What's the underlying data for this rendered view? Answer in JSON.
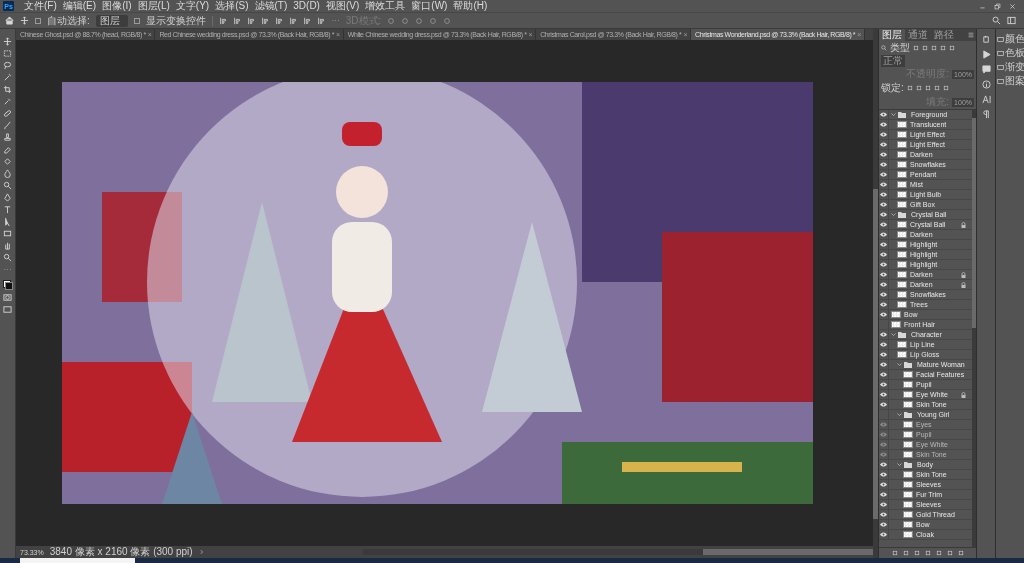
{
  "app_logo": "Ps",
  "menu": [
    "文件(F)",
    "编辑(E)",
    "图像(I)",
    "图层(L)",
    "文字(Y)",
    "选择(S)",
    "滤镜(T)",
    "3D(D)",
    "视图(V)",
    "增效工具",
    "窗口(W)",
    "帮助(H)"
  ],
  "options": {
    "auto_select_label": "自动选择:",
    "auto_select_checked": false,
    "target": "图层",
    "show_transform_label": "显示变换控件",
    "show_transform_checked": false,
    "mode_3d": "3D模式:"
  },
  "document_tabs": [
    {
      "label": "Chinese Ghost.psd @ 88.7% (head, RGB/8) *",
      "close": "×",
      "selected": false
    },
    {
      "label": "Red Chinese wedding dress.psd @ 73.3% (Back Hair, RGB/8) *",
      "close": "×",
      "selected": false
    },
    {
      "label": "White Chinese wedding dress.psd @ 73.3% (Back Hair, RGB/8) *",
      "close": "×",
      "selected": false
    },
    {
      "label": "Christmas Carol.psd @ 73.3% (Back Hair, RGB/8) *",
      "close": "×",
      "selected": false
    },
    {
      "label": "Christmas Wonderland.psd @ 73.3% (Back Hair, RGB/8) *",
      "close": "×",
      "selected": true
    }
  ],
  "layers_panel": {
    "tabs": [
      {
        "label": "图层",
        "selected": true
      },
      {
        "label": "通道",
        "selected": false
      },
      {
        "label": "路径",
        "selected": false
      }
    ],
    "filter": "类型",
    "blend_mode": "正常",
    "opacity_label": "不透明度:",
    "opacity": "100%",
    "lock_label": "锁定:",
    "fill_label": "填充:",
    "fill": "100%",
    "layers": [
      {
        "name": "Foreground",
        "kind": "group",
        "visible": true,
        "locked": false,
        "expanded": true,
        "children": [
          {
            "name": "Translucent",
            "kind": "layer",
            "visible": true,
            "locked": false
          },
          {
            "name": "Light Effect",
            "kind": "layer",
            "visible": true,
            "locked": false
          },
          {
            "name": "Light Effect",
            "kind": "layer",
            "visible": true,
            "locked": false
          },
          {
            "name": "Darken",
            "kind": "layer",
            "visible": true,
            "locked": false
          },
          {
            "name": "Snowflakes",
            "kind": "layer",
            "visible": true,
            "locked": false
          },
          {
            "name": "Pendant",
            "kind": "layer",
            "visible": true,
            "locked": false
          },
          {
            "name": "Mist",
            "kind": "layer",
            "visible": true,
            "locked": false
          },
          {
            "name": "Light Bulb",
            "kind": "layer",
            "visible": true,
            "locked": false
          },
          {
            "name": "Gift Box",
            "kind": "layer",
            "visible": true,
            "locked": false
          }
        ]
      },
      {
        "name": "Crystal Ball",
        "kind": "group",
        "visible": true,
        "locked": false,
        "expanded": true,
        "children": [
          {
            "name": "Crystal Ball",
            "kind": "layer",
            "visible": true,
            "locked": true
          },
          {
            "name": "Darken",
            "kind": "layer",
            "visible": true,
            "locked": false
          },
          {
            "name": "Highlight",
            "kind": "layer",
            "visible": true,
            "locked": false
          },
          {
            "name": "Highlight",
            "kind": "layer",
            "visible": true,
            "locked": false
          },
          {
            "name": "Highlight",
            "kind": "layer",
            "visible": true,
            "locked": false
          },
          {
            "name": "Darken",
            "kind": "layer",
            "visible": true,
            "locked": true
          },
          {
            "name": "Darken",
            "kind": "layer",
            "visible": true,
            "locked": true
          },
          {
            "name": "Snowflakes",
            "kind": "layer",
            "visible": true,
            "locked": false
          },
          {
            "name": "Trees",
            "kind": "layer",
            "visible": true,
            "locked": false
          }
        ]
      },
      {
        "name": "Bow",
        "kind": "layer",
        "visible": true,
        "locked": false
      },
      {
        "name": "Front Hair",
        "kind": "layer",
        "visible": false,
        "locked": false
      },
      {
        "name": "Character",
        "kind": "group",
        "visible": true,
        "locked": false,
        "expanded": true,
        "children": [
          {
            "name": "Lip Line",
            "kind": "layer",
            "visible": true,
            "locked": false
          },
          {
            "name": "Lip Gloss",
            "kind": "layer",
            "visible": true,
            "locked": false
          },
          {
            "name": "Mature Woman",
            "kind": "group",
            "visible": true,
            "locked": false,
            "expanded": true,
            "children": [
              {
                "name": "Facial Features",
                "kind": "layer",
                "visible": true,
                "locked": false
              },
              {
                "name": "Pupil",
                "kind": "layer",
                "visible": true,
                "locked": false
              },
              {
                "name": "Eye White",
                "kind": "layer",
                "visible": true,
                "locked": true
              },
              {
                "name": "Skin Tone",
                "kind": "layer",
                "visible": true,
                "locked": false
              }
            ]
          },
          {
            "name": "Young Girl",
            "kind": "group",
            "visible": false,
            "locked": false,
            "expanded": true,
            "children": [
              {
                "name": "Eyes",
                "kind": "layer",
                "visible": true,
                "locked": false
              },
              {
                "name": "Pupil",
                "kind": "layer",
                "visible": true,
                "locked": false
              },
              {
                "name": "Eye White",
                "kind": "layer",
                "visible": true,
                "locked": false
              },
              {
                "name": "Skin Tone",
                "kind": "layer",
                "visible": true,
                "locked": false
              }
            ]
          },
          {
            "name": "Body",
            "kind": "group",
            "visible": true,
            "locked": false,
            "expanded": true,
            "children": [
              {
                "name": "Skin Tone",
                "kind": "layer",
                "visible": true,
                "locked": false
              },
              {
                "name": "Sleeves",
                "kind": "layer",
                "visible": true,
                "locked": false
              },
              {
                "name": "Fur Trim",
                "kind": "layer",
                "visible": true,
                "locked": false
              },
              {
                "name": "Sleeves",
                "kind": "layer",
                "visible": true,
                "locked": false
              },
              {
                "name": "Gold Thread",
                "kind": "layer",
                "visible": true,
                "locked": false
              },
              {
                "name": "Bow",
                "kind": "layer",
                "visible": true,
                "locked": false
              },
              {
                "name": "Cloak",
                "kind": "layer",
                "visible": true,
                "locked": false
              }
            ]
          }
        ]
      }
    ]
  },
  "side_panels": [
    "颜色",
    "色板",
    "渐变",
    "图案"
  ],
  "status_bar": {
    "zoom": "73.33%",
    "doc_info": "3840 像素 x 2160 像素 (300 ppi)"
  }
}
